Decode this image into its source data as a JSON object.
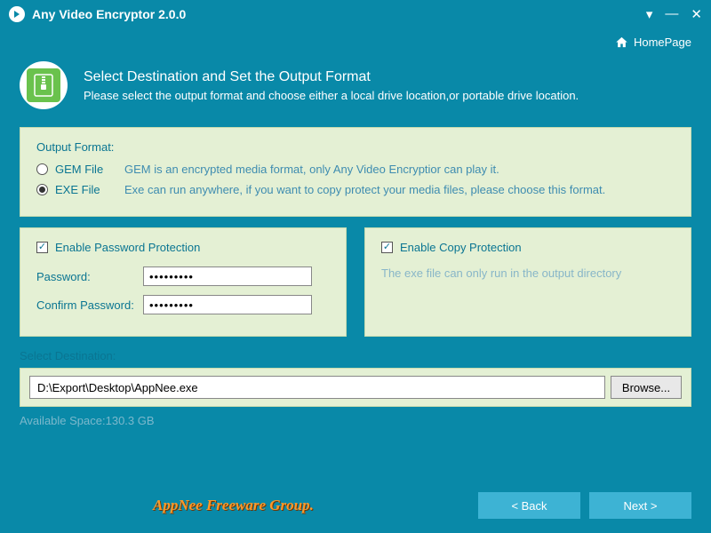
{
  "app": {
    "title": "Any Video Encryptor 2.0.0"
  },
  "home_link": "HomePage",
  "header": {
    "title": "Select Destination and Set the Output Format",
    "subtitle": "Please select the output format and choose either a local drive location,or portable drive location."
  },
  "output_format": {
    "title": "Output Format:",
    "options": [
      {
        "label": "GEM File",
        "desc": "GEM is an encrypted media format, only Any Video Encryptior can play it.",
        "selected": false
      },
      {
        "label": "EXE File",
        "desc": "Exe can run anywhere, if you want to copy protect your media files, please choose this format.",
        "selected": true
      }
    ]
  },
  "password_protection": {
    "enabled": true,
    "label": "Enable Password Protection",
    "password_label": "Password:",
    "password_value": "•••••••••",
    "confirm_label": "Confirm Password:",
    "confirm_value": "•••••••••"
  },
  "copy_protection": {
    "enabled": true,
    "label": "Enable Copy Protection",
    "desc": "The exe file can only run in the output directory"
  },
  "destination": {
    "label": "Select Destination:",
    "path": "D:\\Export\\Desktop\\AppNee.exe",
    "browse": "Browse..."
  },
  "available_space": "Available Space:130.3 GB",
  "watermark": "AppNee Freeware Group.",
  "buttons": {
    "back": "< Back",
    "next": "Next >"
  }
}
